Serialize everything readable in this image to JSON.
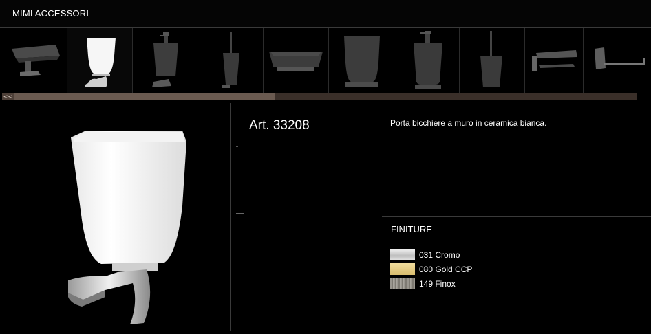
{
  "header": {
    "title": "MIMI ACCESSORI"
  },
  "thumbnails": [
    {
      "name": "soap-dish-thumbnail",
      "active": false
    },
    {
      "name": "tumbler-holder-thumbnail",
      "active": true
    },
    {
      "name": "soap-dispenser-wall-thumbnail",
      "active": false
    },
    {
      "name": "toilet-brush-wall-thumbnail",
      "active": false
    },
    {
      "name": "soap-dish-standing-thumbnail",
      "active": false
    },
    {
      "name": "tumbler-standing-thumbnail",
      "active": false
    },
    {
      "name": "soap-dispenser-standing-thumbnail",
      "active": false
    },
    {
      "name": "toilet-brush-standing-thumbnail",
      "active": false
    },
    {
      "name": "paper-holder-covered-thumbnail",
      "active": false
    },
    {
      "name": "paper-holder-thumbnail",
      "active": false
    }
  ],
  "scrollbar": {
    "left_arrow": "<<",
    "position": 0.43
  },
  "product": {
    "article": "Art. 33208",
    "description": "Porta bicchiere a muro in ceramica bianca."
  },
  "finishes": {
    "title": "FINITURE",
    "items": [
      {
        "label": "031 Cromo",
        "color": "#d8d8d8"
      },
      {
        "label": "080 Gold CCP",
        "color": "#e8d08a"
      },
      {
        "label": "149 Finox",
        "color": "#8e8a82"
      }
    ]
  }
}
